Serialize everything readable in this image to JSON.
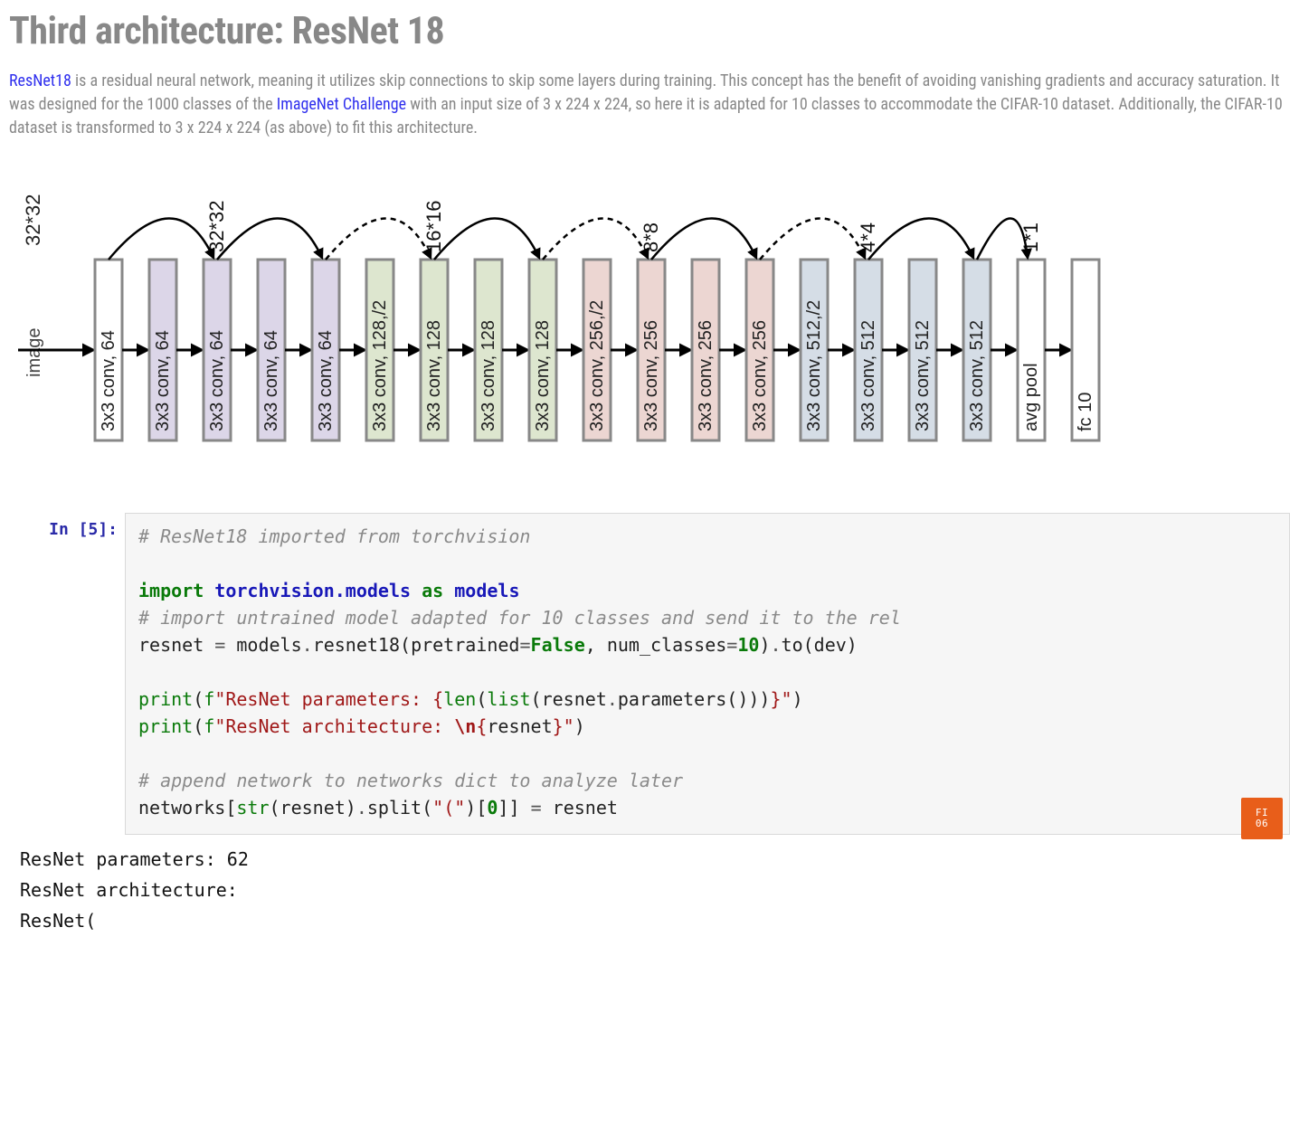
{
  "title": "Third architecture: ResNet 18",
  "paragraph": {
    "link1_text": "ResNet18",
    "text1": " is a residual neural network, meaning it utilizes skip connections to skip some layers during training. This concept has the benefit of avoiding vanishing gradients and accuracy saturation. It was designed for the 1000 classes of the ",
    "link2_text": "ImageNet Challenge",
    "text2": " with an input size of 3 x 224 x 224, so here it is adapted for 10 classes to accommodate the CIFAR-10 dataset. Additionally, the CIFAR-10 dataset is transformed to 3 x 224 x 224 (as above) to fit this architecture."
  },
  "diagram": {
    "input_label": "image",
    "input_size": "32*32",
    "blocks": [
      {
        "label": "3x3 conv, 64",
        "fill": "#ffffff",
        "size_above": ""
      },
      {
        "label": "3x3 conv, 64",
        "fill": "#dcd6e8",
        "size_above": ""
      },
      {
        "label": "3x3 conv, 64",
        "fill": "#dcd6e8",
        "size_above": "32*32"
      },
      {
        "label": "3x3 conv, 64",
        "fill": "#dcd6e8",
        "size_above": ""
      },
      {
        "label": "3x3 conv, 64",
        "fill": "#dcd6e8",
        "size_above": ""
      },
      {
        "label": "3x3 conv, 128,/2",
        "fill": "#dde6cf",
        "size_above": ""
      },
      {
        "label": "3x3 conv, 128",
        "fill": "#dde6cf",
        "size_above": "16*16"
      },
      {
        "label": "3x3 conv, 128",
        "fill": "#dde6cf",
        "size_above": ""
      },
      {
        "label": "3x3 conv, 128",
        "fill": "#dde6cf",
        "size_above": ""
      },
      {
        "label": "3x3 conv, 256,/2",
        "fill": "#ecd6d2",
        "size_above": ""
      },
      {
        "label": "3x3 conv, 256",
        "fill": "#ecd6d2",
        "size_above": "8*8"
      },
      {
        "label": "3x3 conv, 256",
        "fill": "#ecd6d2",
        "size_above": ""
      },
      {
        "label": "3x3 conv, 256",
        "fill": "#ecd6d2",
        "size_above": ""
      },
      {
        "label": "3x3 conv, 512,/2",
        "fill": "#d5dde6",
        "size_above": ""
      },
      {
        "label": "3x3 conv, 512",
        "fill": "#d5dde6",
        "size_above": "4*4"
      },
      {
        "label": "3x3 conv, 512",
        "fill": "#d5dde6",
        "size_above": ""
      },
      {
        "label": "3x3 conv, 512",
        "fill": "#d5dde6",
        "size_above": ""
      },
      {
        "label": "avg pool",
        "fill": "#ffffff",
        "size_above": "1*1"
      },
      {
        "label": "fc 10",
        "fill": "#ffffff",
        "size_above": ""
      }
    ],
    "skip_arcs": [
      {
        "from": 0,
        "to": 2,
        "style": "solid"
      },
      {
        "from": 2,
        "to": 4,
        "style": "solid"
      },
      {
        "from": 4,
        "to": 6,
        "style": "dashed"
      },
      {
        "from": 6,
        "to": 8,
        "style": "solid"
      },
      {
        "from": 8,
        "to": 10,
        "style": "dashed"
      },
      {
        "from": 10,
        "to": 12,
        "style": "solid"
      },
      {
        "from": 12,
        "to": 14,
        "style": "dashed"
      },
      {
        "from": 14,
        "to": 16,
        "style": "solid"
      },
      {
        "from": 16,
        "to": 17,
        "style": "solid"
      }
    ]
  },
  "cell": {
    "prompt": "In [5]:",
    "code": {
      "c1": "# ResNet18 imported from torchvision",
      "kw_import": "import",
      "mod": "torchvision.models",
      "kw_as": "as",
      "alias": "models",
      "c2": "# import untrained model adapted for 10 classes and send it to the rel",
      "l3_a": "resnet ",
      "l3_eq": "=",
      "l3_b": " models",
      "l3_dot1": ".",
      "l3_fn": "resnet18",
      "l3_p1": "(",
      "l3_kw1": "pretrained",
      "l3_eq2": "=",
      "l3_false": "False",
      "l3_comma": ", ",
      "l3_kw2": "num_classes",
      "l3_eq3": "=",
      "l3_int": "10",
      "l3_p2": ")",
      "l3_dot2": ".",
      "l3_to": "to",
      "l3_p3": "(",
      "l3_dev": "dev",
      "l3_p4": ")",
      "print1_fn": "print",
      "print1_p1": "(",
      "print1_f": "f",
      "print1_q1": "\"ResNet parameters: ",
      "print1_bro": "{",
      "print1_len": "len",
      "print1_po": "(",
      "print1_list": "list",
      "print1_po2": "(",
      "print1_res": "resnet",
      "print1_dot": ".",
      "print1_par": "parameters",
      "print1_pc": "()))",
      "print1_brc": "}",
      "print1_q2": "\"",
      "print1_pc2": ")",
      "print2_fn": "print",
      "print2_p1": "(",
      "print2_f": "f",
      "print2_q1": "\"ResNet architecture: ",
      "print2_nl": "\\n",
      "print2_bro": "{",
      "print2_res": "resnet",
      "print2_brc": "}",
      "print2_q2": "\"",
      "print2_pc": ")",
      "c3": "# append network to networks dict to analyze later",
      "l8_a": "networks",
      "l8_b1": "[",
      "l8_str": "str",
      "l8_p1": "(",
      "l8_res": "resnet",
      "l8_p2": ")",
      "l8_dot": ".",
      "l8_split": "split",
      "l8_p3": "(",
      "l8_q": "\"(\"",
      "l8_p4": ")",
      "l8_b2": "[",
      "l8_zero": "0",
      "l8_b3": "]",
      "l8_b4": "]",
      "l8_sp": " ",
      "l8_eq": "=",
      "l8_sp2": " ",
      "l8_res2": "resnet"
    },
    "output_lines": [
      "ResNet parameters: 62",
      "ResNet architecture:",
      "ResNet("
    ]
  },
  "badge_text": "FI\n06"
}
